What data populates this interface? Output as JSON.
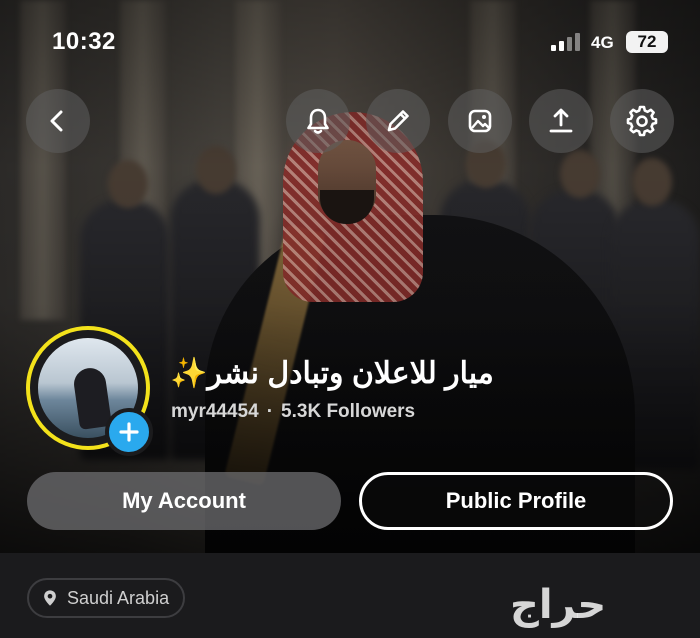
{
  "status_bar": {
    "time": "10:32",
    "network": "4G",
    "battery": "72"
  },
  "toolbar": {
    "back_icon": "chevron-left-icon",
    "notification_icon": "bell-icon",
    "edit_icon": "pencil-icon",
    "background_icon": "image-icon",
    "share_icon": "share-upload-icon",
    "settings_icon": "gear-icon"
  },
  "profile": {
    "display_name": "ميار للاعلان وتبادل نشر✨",
    "username": "myr44454",
    "separator": "·",
    "followers": "5.3K Followers",
    "story_ring_color": "#f3e21b",
    "add_badge_color": "#2aa9ee"
  },
  "actions": {
    "my_account": "My Account",
    "public_profile": "Public Profile"
  },
  "location": {
    "label": "Saudi Arabia"
  },
  "watermark": {
    "text": "حراج"
  }
}
